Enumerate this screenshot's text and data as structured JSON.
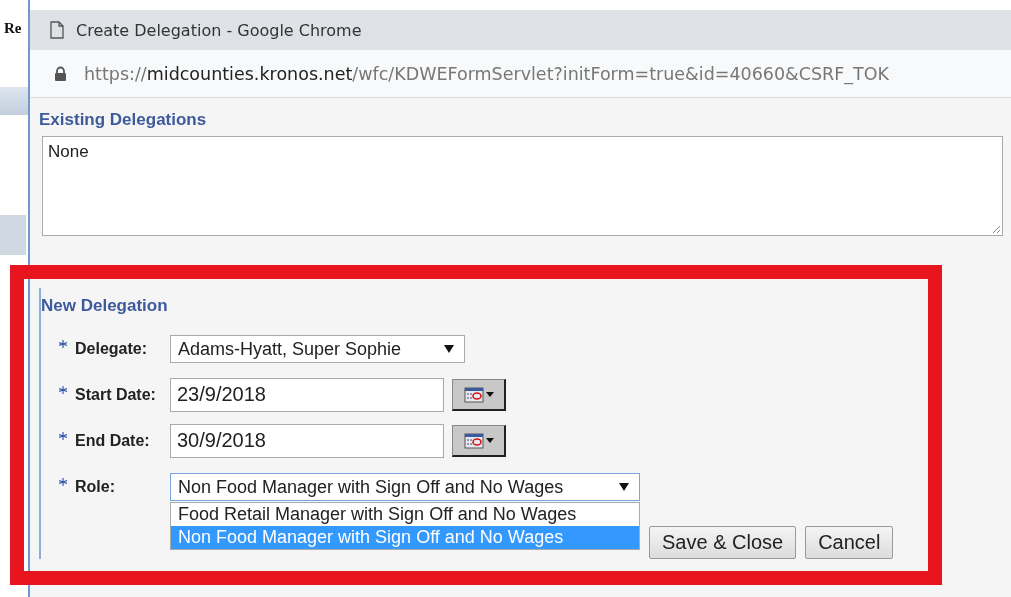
{
  "background_app": {
    "title_fragment": "Re"
  },
  "window": {
    "title": "Create Delegation - Google Chrome"
  },
  "address_bar": {
    "scheme": "https://",
    "host": "midcounties.kronos.net",
    "path": "/wfc/KDWEFormServlet?initForm=true&id=40660&CSRF_TOK"
  },
  "existing": {
    "heading": "Existing Delegations",
    "value": "None"
  },
  "new_delegation": {
    "heading": "New Delegation",
    "fields": [
      {
        "kind": "select",
        "label": "Delegate:",
        "required": true,
        "value": "Adams-Hyatt, Super Sophie"
      },
      {
        "kind": "date",
        "label": "Start Date:",
        "required": true,
        "value": "23/9/2018"
      },
      {
        "kind": "date",
        "label": "End Date:",
        "required": true,
        "value": "30/9/2018"
      },
      {
        "kind": "select",
        "label": "Role:",
        "required": true,
        "value": "Non Food Manager with Sign Off and No Wages",
        "expanded": true,
        "options": [
          {
            "label": "Food Retail Manager with Sign Off and No Wages",
            "selected": false
          },
          {
            "label": "Non Food Manager with Sign Off and No Wages",
            "selected": true
          }
        ]
      }
    ],
    "buttons": [
      "Save & Close",
      "Cancel"
    ]
  }
}
